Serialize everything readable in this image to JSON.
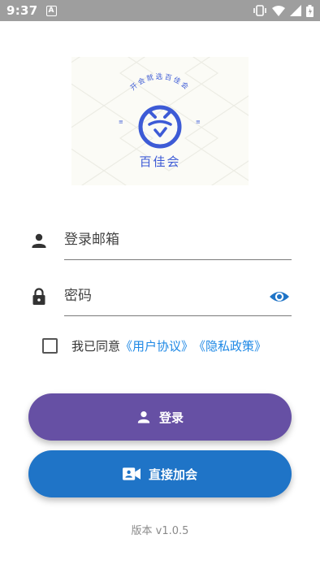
{
  "status_bar": {
    "time": "9:37",
    "notification_letter": "A"
  },
  "logo": {
    "slogan": "开会就选百佳会",
    "brand": "百佳会",
    "brand_color": "#3d5bd6"
  },
  "form": {
    "email_placeholder": "登录邮箱",
    "password_placeholder": "密码"
  },
  "agreement": {
    "prefix": "我已同意",
    "user_agreement": "《用户协议》",
    "privacy_policy": "《隐私政策》",
    "checked": false,
    "link_color": "#1e88e5"
  },
  "buttons": {
    "login_label": "登录",
    "login_color": "#6650a4",
    "join_label": "直接加会",
    "join_color": "#1f74c7"
  },
  "footer": {
    "version": "版本 v1.0.5"
  },
  "icons": {
    "email": "person-icon",
    "password": "lock-icon",
    "toggle_password": "eye-icon",
    "login": "person-icon",
    "join": "video-camera-icon"
  }
}
